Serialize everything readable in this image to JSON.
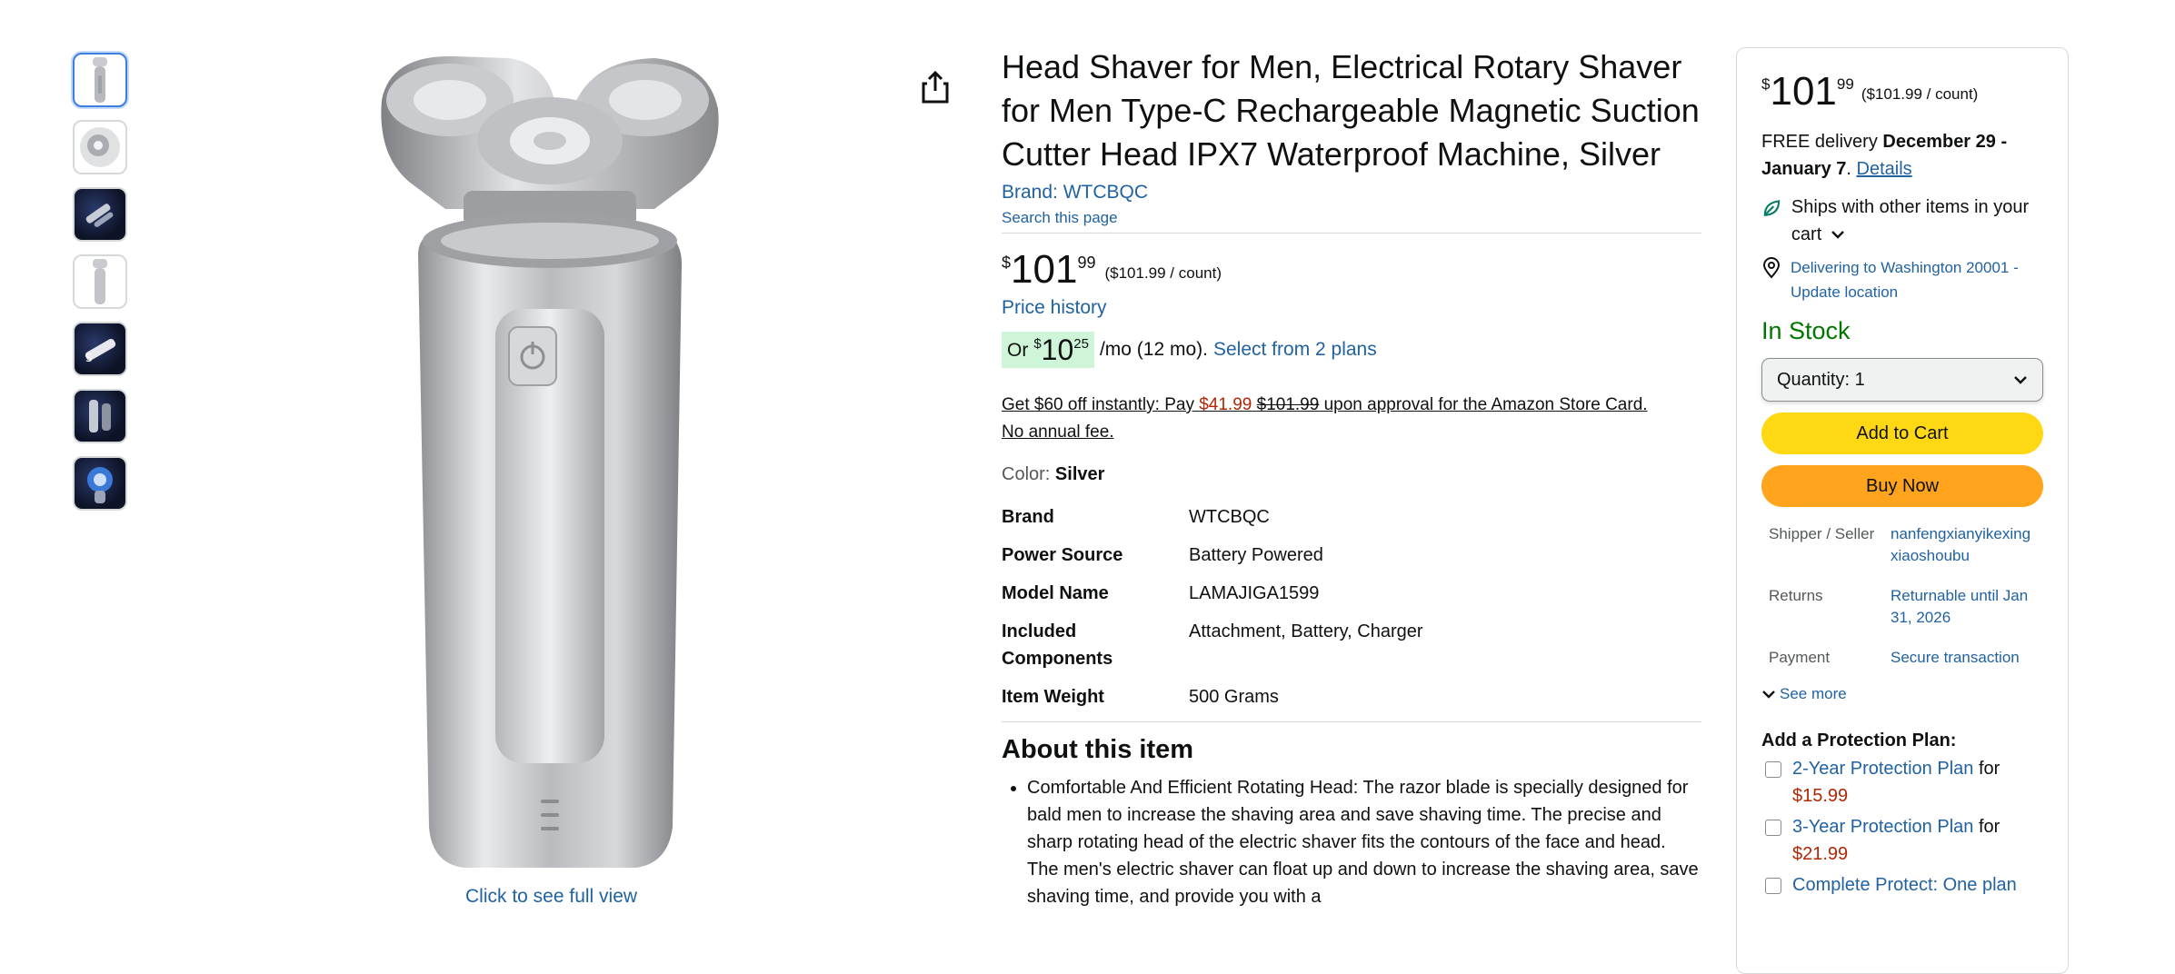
{
  "gallery": {
    "thumbnails": [
      {
        "icon": "shaver-silver-thumb"
      },
      {
        "icon": "shaver-head-thumb"
      },
      {
        "icon": "blades-dark-thumb"
      },
      {
        "icon": "shaver-front-thumb"
      },
      {
        "icon": "shaver-dark-thumb"
      },
      {
        "icon": "shaver-hand-thumb"
      },
      {
        "icon": "shaver-water-thumb"
      }
    ],
    "see_full_view": "Click to see full view"
  },
  "product": {
    "title": "Head Shaver for Men, Electrical Rotary Shaver for Men Type-C Rechargeable Magnetic Suction Cutter Head IPX7 Waterproof Machine, Silver",
    "brand_link": "Brand: WTCBQC",
    "search_page": "Search this page",
    "price": {
      "currency": "$",
      "whole": "101",
      "fraction": "99",
      "per_unit": "($101.99 / count)"
    },
    "price_history": "Price history",
    "installment": {
      "prefix": "Or",
      "currency": "$",
      "whole": "10",
      "fraction": "25",
      "suffix": "/mo (12 mo).",
      "link": "Select from 2 plans"
    },
    "promo": {
      "part1": "Get $60 off instantly: Pay ",
      "pay": "$41.99",
      "space": " ",
      "was": "$101.99",
      "part2": " upon approval for the Amazon Store Card.",
      "line2": "No annual fee."
    },
    "color_label": "Color:",
    "color_value": "Silver",
    "specs": [
      {
        "key": "Brand",
        "value": "WTCBQC"
      },
      {
        "key": "Power Source",
        "value": "Battery Powered"
      },
      {
        "key": "Model Name",
        "value": "LAMAJIGA1599"
      },
      {
        "key": "Included Components",
        "value": "Attachment, Battery, Charger"
      },
      {
        "key": "Item Weight",
        "value": "500 Grams"
      }
    ],
    "about_heading": "About this item",
    "bullets": [
      "Comfortable And Efficient Rotating Head: The razor blade is specially designed for bald men to increase the shaving area and save shaving time. The precise and sharp rotating head of the electric shaver fits the contours of the face and head. The men's electric shaver can float up and down to increase the shaving area, save shaving time, and provide you with a"
    ]
  },
  "buybox": {
    "price": {
      "currency": "$",
      "whole": "101",
      "fraction": "99",
      "per_unit": "($101.99 / count)"
    },
    "delivery_prefix": "FREE delivery ",
    "delivery_dates": "December 29 - January 7",
    "delivery_dot": ". ",
    "details": "Details",
    "ships_with": "Ships with other items in your cart",
    "location": "Delivering to Washington 20001 - Update location",
    "stock": "In Stock",
    "quantity_label": "Quantity:",
    "quantity_value": "1",
    "add_to_cart": "Add to Cart",
    "buy_now": "Buy Now",
    "info": [
      {
        "key": "Shipper / Seller",
        "value": "nanfengxianyikexingxiaoshoubu"
      },
      {
        "key": "Returns",
        "value": "Returnable until Jan 31, 2026"
      },
      {
        "key": "Payment",
        "value": "Secure transaction"
      }
    ],
    "see_more": "See more",
    "protection_heading": "Add a Protection Plan:",
    "protection_plans": [
      {
        "name": "2-Year Protection Plan",
        "for": "for",
        "price": "$15.99"
      },
      {
        "name": "3-Year Protection Plan",
        "for": "for",
        "price": "$21.99"
      },
      {
        "name": "Complete Protect: One plan",
        "for": "",
        "price": ""
      }
    ]
  },
  "colors": {
    "link": "#2162a1",
    "stock": "#007600",
    "cart": "#ffd814",
    "buy": "#ffa41c",
    "price_red": "#b12704"
  }
}
